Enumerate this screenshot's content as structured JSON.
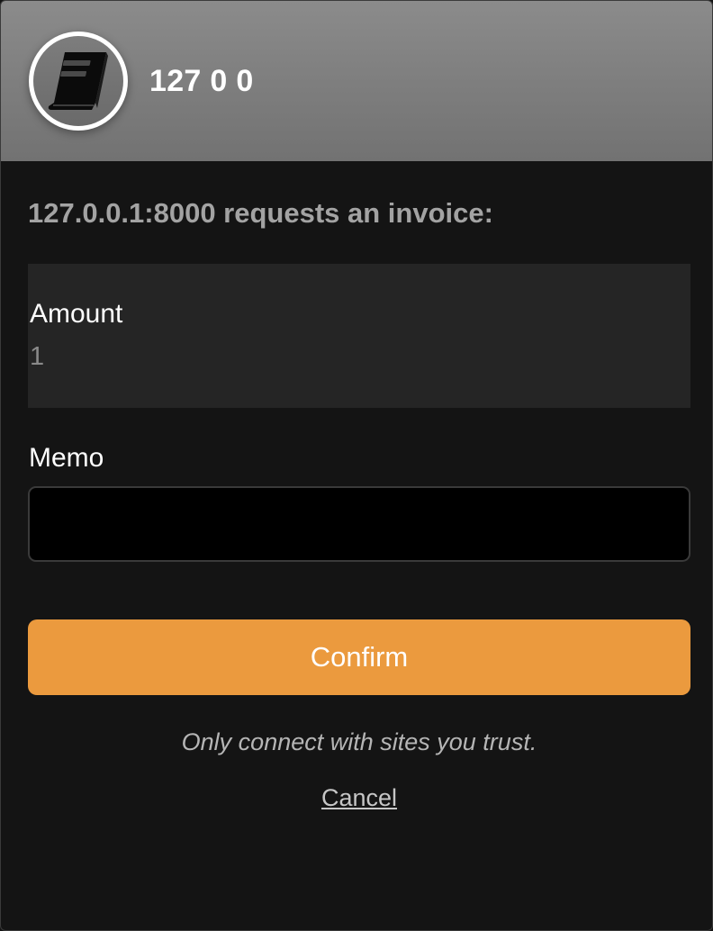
{
  "header": {
    "site_title": "127 0 0",
    "avatar_icon": "book-icon"
  },
  "request": {
    "text": "127.0.0.1:8000 requests an invoice:"
  },
  "amount": {
    "label": "Amount",
    "value": "1"
  },
  "memo": {
    "label": "Memo",
    "value": "",
    "placeholder": ""
  },
  "actions": {
    "confirm_label": "Confirm",
    "trust_note": "Only connect with sites you trust.",
    "cancel_label": "Cancel"
  },
  "colors": {
    "accent": "#eb9a3e",
    "background": "#141414",
    "header_gradient_top": "#8b8b8b",
    "header_gradient_bottom": "#727272"
  }
}
